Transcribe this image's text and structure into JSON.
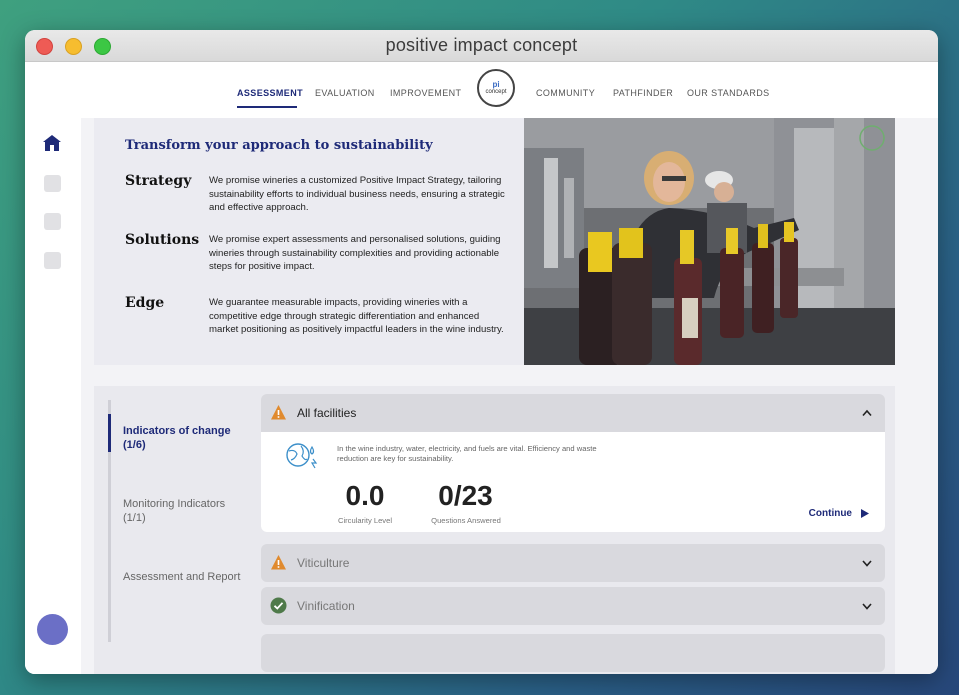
{
  "window": {
    "title": "positive impact concept"
  },
  "nav": {
    "items": [
      "ASSESSMENT",
      "EVALUATION",
      "IMPROVEMENT",
      "COMMUNITY",
      "PATHFINDER",
      "OUR STANDARDS"
    ],
    "logo_top": "pi",
    "logo_bottom": "concept"
  },
  "hero": {
    "heading": "Transform your approach to sustainability",
    "promises": [
      {
        "title": "Strategy",
        "text": "We promise wineries a customized Positive Impact Strategy, tailoring sustainability efforts to individual business needs, ensuring a strategic and effective approach."
      },
      {
        "title": "Solutions",
        "text": "We promise expert assessments and personalised solutions, guiding wineries through sustainability complexities and providing actionable steps for positive impact."
      },
      {
        "title": "Edge",
        "text": "We guarantee measurable impacts, providing wineries with a competitive edge through strategic differentiation and enhanced market positioning as positively impactful leaders in the wine industry."
      }
    ]
  },
  "steps": [
    {
      "label": "Indicators of change (1/6)"
    },
    {
      "label": "Monitoring Indicators (1/1)"
    },
    {
      "label": "Assessment and Report"
    }
  ],
  "accordion": {
    "all_facilities": {
      "title": "All facilities",
      "description": "In the wine industry, water, electricity, and fuels are vital. Efficiency and waste reduction are key for sustainability.",
      "metric1_value": "0.0",
      "metric1_label": "Circularity Level",
      "metric2_value": "0/23",
      "metric2_label": "Questions Answered",
      "continue_label": "Continue"
    },
    "viticulture": {
      "title": "Viticulture"
    },
    "vinification": {
      "title": "Vinification"
    }
  },
  "colors": {
    "accent": "#1e2a78",
    "warning": "#e08a2e",
    "success": "#4f7a4a",
    "avatar": "#6b6fc6"
  }
}
